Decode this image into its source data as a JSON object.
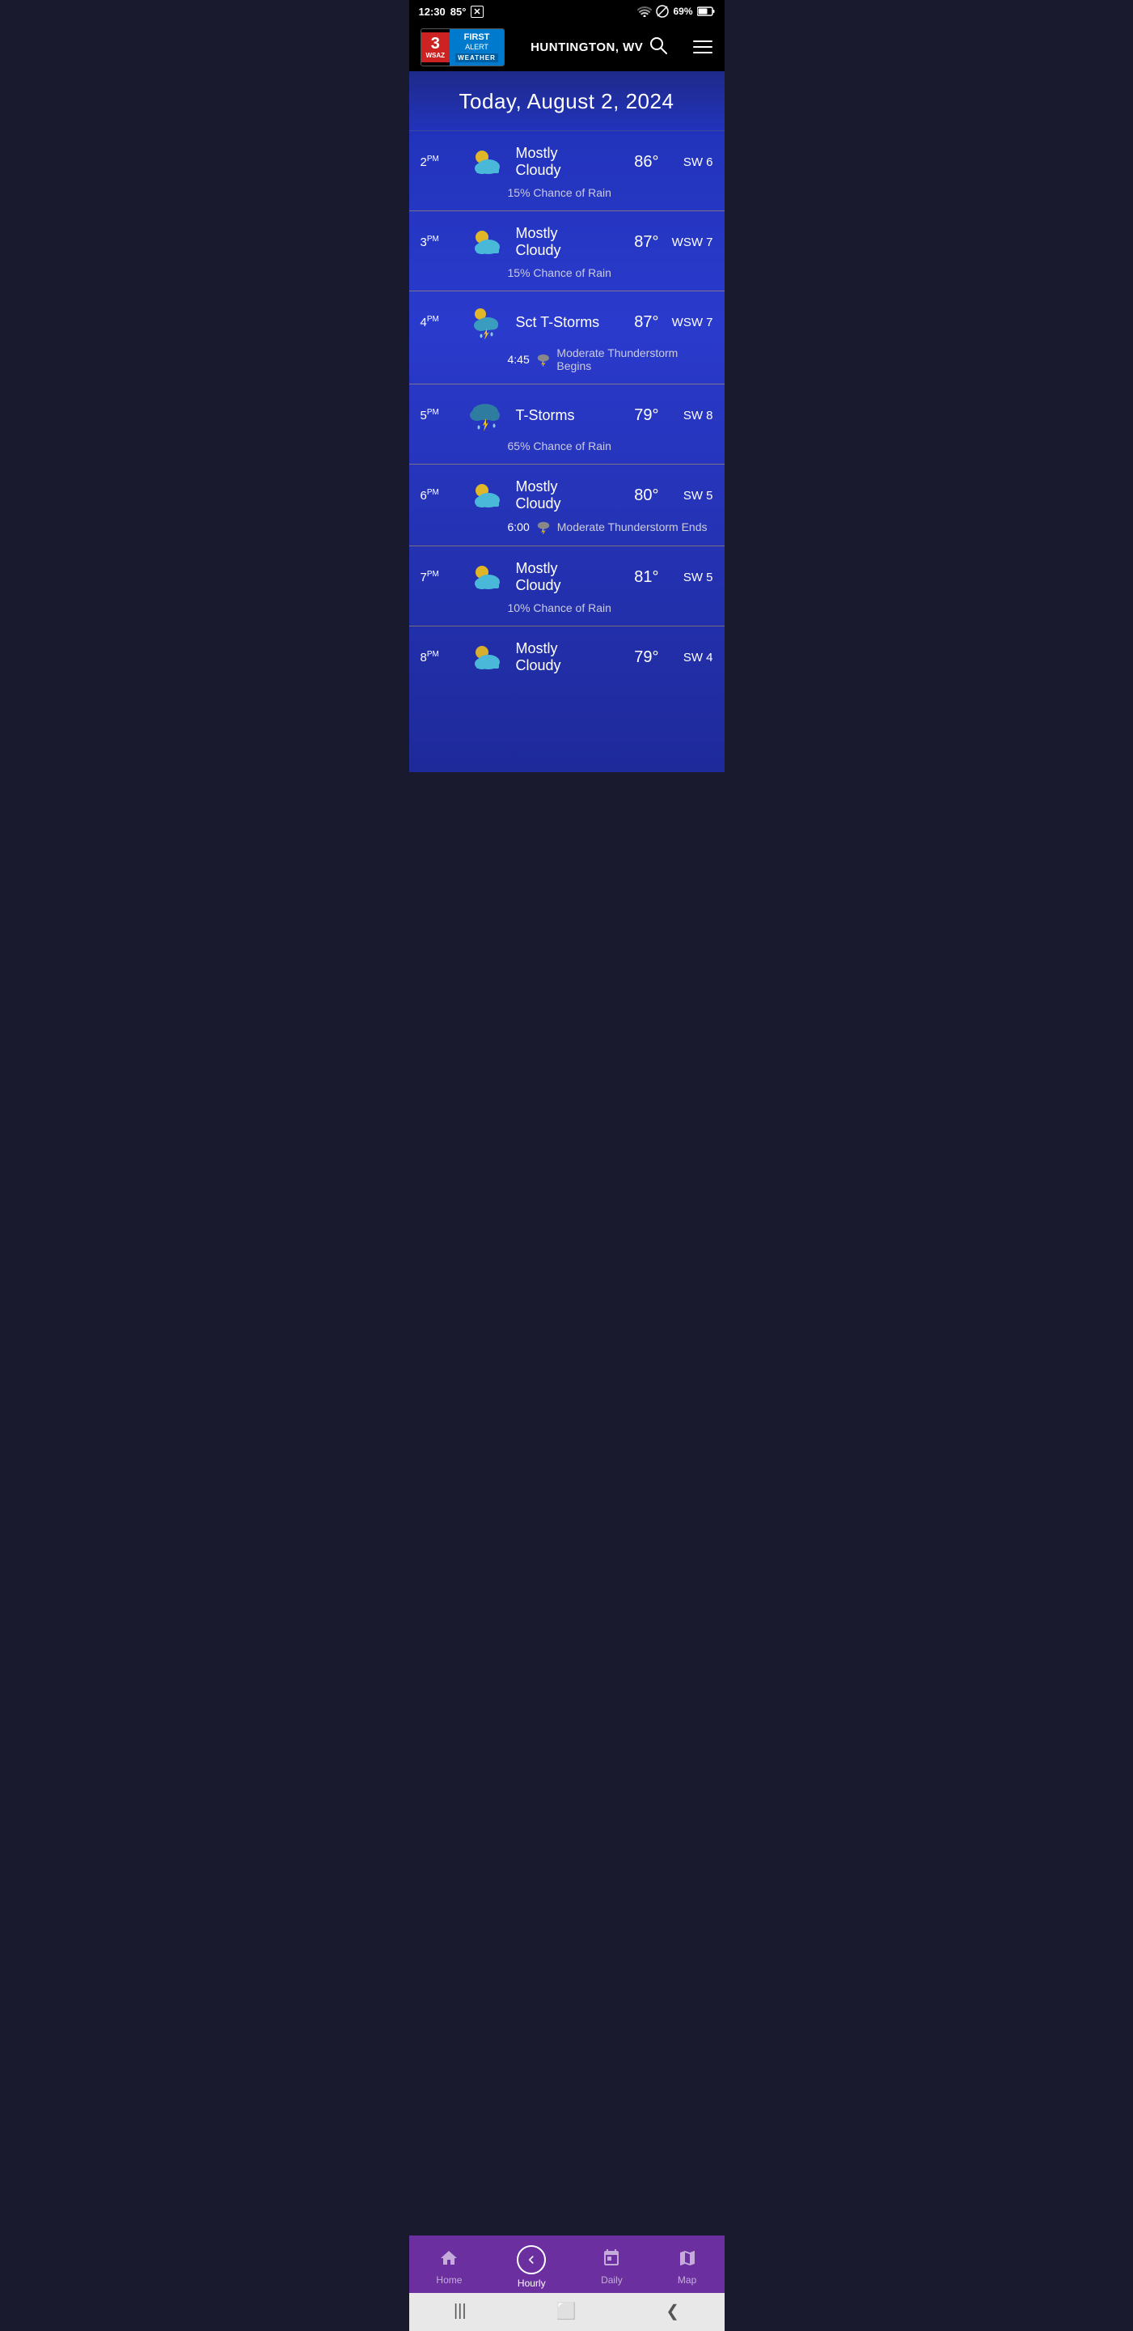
{
  "app": {
    "title": "WSAZ First Alert Weather"
  },
  "status_bar": {
    "time": "12:30",
    "temperature": "85°",
    "battery": "69%",
    "wifi": true,
    "dnd": true
  },
  "header": {
    "location": "HUNTINGTON, WV",
    "logo_channel": "3",
    "logo_ws": "WSAZ",
    "logo_first": "FIRST",
    "logo_alert": "ALERT",
    "logo_weather": "WEATHER",
    "menu_label": "Menu",
    "search_label": "Search"
  },
  "date_banner": {
    "label": "Today, August 2, 2024"
  },
  "hourly": [
    {
      "time": "2",
      "period": "PM",
      "condition": "Mostly Cloudy",
      "temp": "86°",
      "wind": "SW 6",
      "sub": "15% Chance of Rain",
      "sub_icon": null,
      "icon_type": "mostly-cloudy-day"
    },
    {
      "time": "3",
      "period": "PM",
      "condition": "Mostly Cloudy",
      "temp": "87°",
      "wind": "WSW 7",
      "sub": "15% Chance of Rain",
      "sub_icon": null,
      "icon_type": "mostly-cloudy-day"
    },
    {
      "time": "4",
      "period": "PM",
      "condition": "Sct T-Storms",
      "temp": "87°",
      "wind": "WSW 7",
      "sub": "Moderate Thunderstorm Begins",
      "sub_time": "4:45",
      "sub_icon": "thunderstorm",
      "icon_type": "sct-tstorms"
    },
    {
      "time": "5",
      "period": "PM",
      "condition": "T-Storms",
      "temp": "79°",
      "wind": "SW 8",
      "sub": "65% Chance of Rain",
      "sub_icon": null,
      "icon_type": "tstorms"
    },
    {
      "time": "6",
      "period": "PM",
      "condition": "Mostly Cloudy",
      "temp": "80°",
      "wind": "SW 5",
      "sub": "Moderate Thunderstorm Ends",
      "sub_time": "6:00",
      "sub_icon": "thunderstorm",
      "icon_type": "mostly-cloudy-day"
    },
    {
      "time": "7",
      "period": "PM",
      "condition": "Mostly Cloudy",
      "temp": "81°",
      "wind": "SW 5",
      "sub": "10% Chance of Rain",
      "sub_icon": null,
      "icon_type": "mostly-cloudy-day"
    },
    {
      "time": "8",
      "period": "PM",
      "condition": "Mostly Cloudy",
      "temp": "79°",
      "wind": "SW 4",
      "sub": null,
      "sub_icon": null,
      "icon_type": "mostly-cloudy-day"
    }
  ],
  "nav": {
    "items": [
      {
        "id": "home",
        "label": "Home",
        "icon": "🏠",
        "active": false
      },
      {
        "id": "hourly",
        "label": "Hourly",
        "icon": "◀",
        "active": true
      },
      {
        "id": "daily",
        "label": "Daily",
        "icon": "📅",
        "active": false
      },
      {
        "id": "map",
        "label": "Map",
        "icon": "🗺",
        "active": false
      }
    ]
  },
  "system_nav": {
    "back": "❮",
    "home": "⬜",
    "recents": "|||"
  }
}
